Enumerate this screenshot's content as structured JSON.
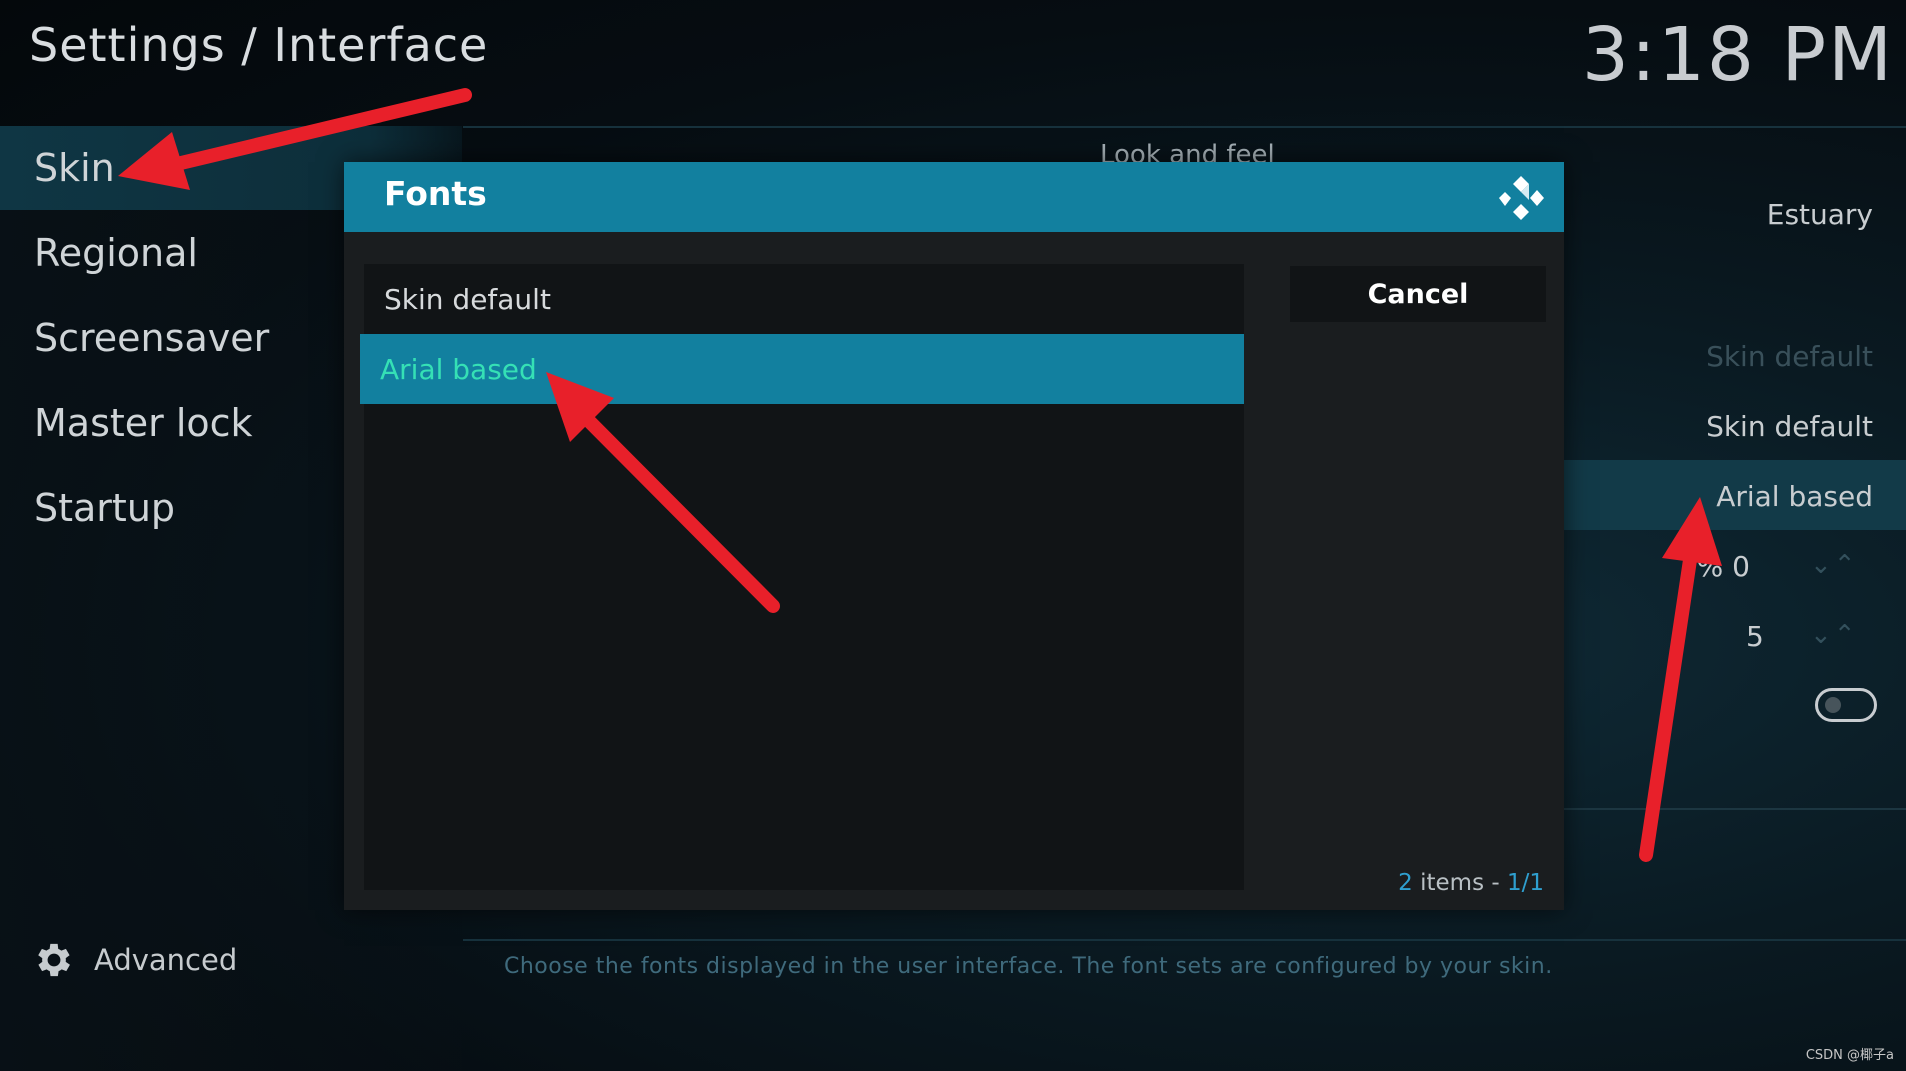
{
  "header": {
    "title": "Settings / Interface",
    "time": "3:18 PM"
  },
  "sidebar": {
    "items": [
      {
        "label": "Skin",
        "active": true
      },
      {
        "label": "Regional"
      },
      {
        "label": "Screensaver"
      },
      {
        "label": "Master lock"
      },
      {
        "label": "Startup"
      }
    ],
    "advanced": {
      "label": "Advanced",
      "icon": "gear-icon"
    }
  },
  "background_panel": {
    "section_label": "Look and feel",
    "values": {
      "skin": "Estuary",
      "theme": "Skin default",
      "colours": "Skin default",
      "fonts": "Arial based",
      "zoom": "0 %",
      "zoom_partial": "0 %",
      "stereo": "5"
    },
    "toggle_on": false
  },
  "dialog": {
    "title": "Fonts",
    "options": [
      {
        "label": "Skin default"
      },
      {
        "label": "Arial based",
        "selected": true
      }
    ],
    "cancel_label": "Cancel",
    "item_count": "2",
    "items_word": "items -",
    "page": "1/1"
  },
  "footer": {
    "hint": "Choose the fonts displayed in the user interface. The font sets are configured by your skin."
  },
  "watermark": "CSDN @椰子a",
  "colors": {
    "accent": "#12809f",
    "selected_text": "#35e0b5",
    "arrow": "#e8202a"
  }
}
